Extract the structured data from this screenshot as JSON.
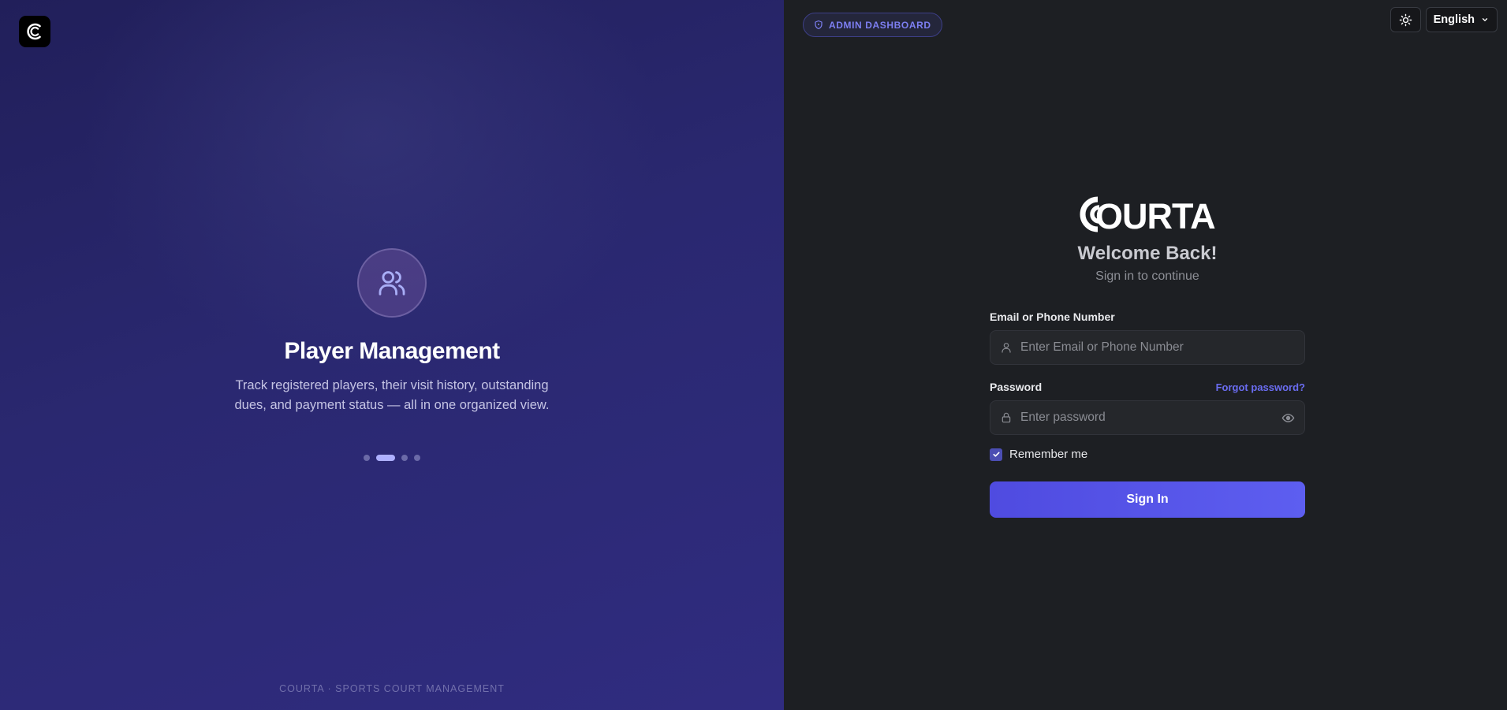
{
  "colors": {
    "accent": "#5b5cf0",
    "left_panel": "#2a2870",
    "right_panel": "#1d1f23"
  },
  "left_panel": {
    "brand_icon": "courta-c-logo-icon",
    "feature": {
      "icon": "users-icon",
      "title": "Player Management",
      "description": "Track registered players, their visit history, outstanding dues, and payment status — all in one organized view."
    },
    "carousel": {
      "total_slides": 4,
      "active_index": 1
    },
    "footer": "COURTA · SPORTS COURT MANAGEMENT"
  },
  "header": {
    "admin_badge": "ADMIN DASHBOARD",
    "admin_badge_icon": "shield-icon",
    "theme_toggle_icon": "sun-icon",
    "language": "English"
  },
  "login": {
    "logo_text": "OURTA",
    "welcome": "Welcome Back!",
    "subtitle": "Sign in to continue",
    "email_label": "Email or Phone Number",
    "email_placeholder": "Enter Email or Phone Number",
    "password_label": "Password",
    "forgot_password": "Forgot password?",
    "password_placeholder": "Enter password",
    "remember_me": "Remember me",
    "remember_checked": true,
    "sign_in": "Sign In"
  }
}
